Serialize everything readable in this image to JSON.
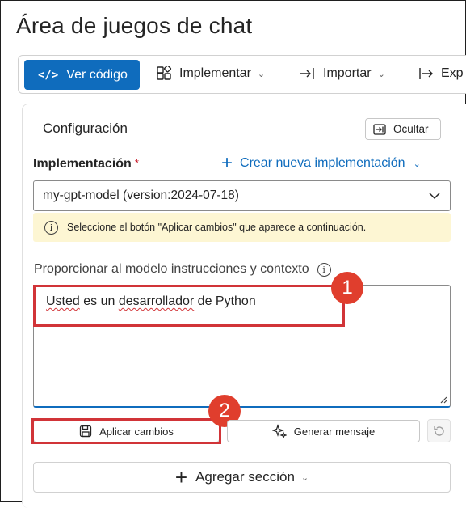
{
  "page": {
    "title": "Área de juegos de chat"
  },
  "toolbar": {
    "view_code_icon": "</>",
    "view_code_label": "Ver código",
    "implement_label": "Implementar",
    "import_label": "Importar",
    "export_label": "Exp"
  },
  "config": {
    "title": "Configuración",
    "hide_label": "Ocultar",
    "deployment_label": "Implementación",
    "required_mark": "*",
    "create_label": "Crear nueva implementación",
    "selected_model": "my-gpt-model (version:2024-07-18)",
    "notice_text": "Seleccione el botón \"Aplicar cambios\" que aparece a continuación.",
    "prompt_label": "Proporcionar al modelo instrucciones y contexto",
    "prompt_value_parts": [
      "Usted",
      " es un ",
      "desarrollador",
      " de Python"
    ],
    "apply_label": "Aplicar cambios",
    "generate_label": "Generar mensaje",
    "add_section_label": "Agregar sección"
  },
  "annotations": {
    "badge_1": "1",
    "badge_2": "2"
  },
  "colors": {
    "primary": "#0f6cbd",
    "notice_bg": "#fdf6d3",
    "highlight": "#d13438",
    "badge": "#e03e2d"
  }
}
